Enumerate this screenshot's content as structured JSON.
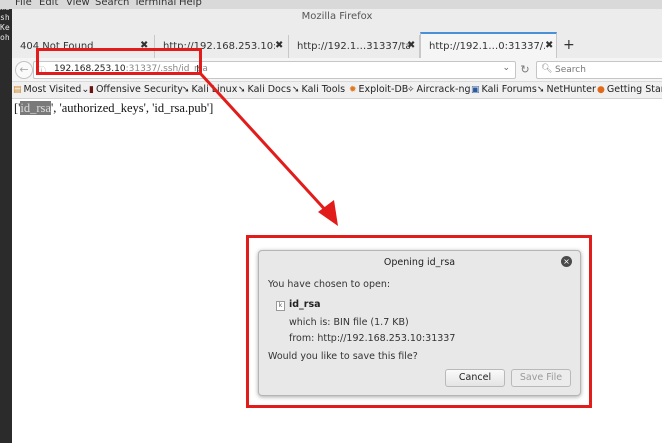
{
  "desktop": {
    "side_fragments": [
      "me",
      "sh",
      "Ke",
      "oh"
    ]
  },
  "os_menu": {
    "items": [
      "File",
      "Edit",
      "View",
      "Search",
      "Terminal",
      "Help"
    ]
  },
  "window": {
    "title": "Mozilla Firefox"
  },
  "tabs": [
    {
      "label": "404 Not Found",
      "close": "✖"
    },
    {
      "label": "http://192.168.253.10:31…",
      "close": "✖"
    },
    {
      "label": "http://192.1…31337/taxes/",
      "close": "✖"
    },
    {
      "label": "http://192.1…0:31337/.ssh",
      "close": "✖"
    }
  ],
  "newtab": "+",
  "navbar": {
    "back": "←",
    "info": "ⓘ",
    "url_host": "192.168.253.10",
    "url_rest": ":31337/.ssh/id_rsa",
    "url_drop": "⌄",
    "reload": "↻",
    "search_placeholder": "Search"
  },
  "bookmarks": [
    {
      "icon": "▤",
      "label": "Most Visited",
      "suffix": "⌄"
    },
    {
      "icon": "▮",
      "label": "Offensive Security"
    },
    {
      "icon": "➘",
      "label": "Kali Linux"
    },
    {
      "icon": "➘",
      "label": "Kali Docs"
    },
    {
      "icon": "➘",
      "label": "Kali Tools"
    },
    {
      "icon": "✹",
      "label": "Exploit-DB"
    },
    {
      "icon": "✧",
      "label": "Aircrack-ng"
    },
    {
      "icon": "▣",
      "label": "Kali Forums"
    },
    {
      "icon": "➘",
      "label": "NetHunter"
    },
    {
      "icon": "●",
      "label": "Getting Started"
    }
  ],
  "content": {
    "open": "['",
    "highlight": "id_rsa",
    "rest": "', 'authorized_keys', 'id_rsa.pub']"
  },
  "dialog": {
    "title": "Opening id_rsa",
    "close": "×",
    "chosen": "You have chosen to open:",
    "filename": "id_rsa",
    "which_is": "which is: BIN file (1.7 KB)",
    "from": "from: http://192.168.253.10:31337",
    "question": "Would you like to save this file?",
    "cancel": "Cancel",
    "save": "Save File"
  },
  "colors": {
    "highlight_red": "#e21b1b",
    "active_tab_accent": "#4a90d9"
  }
}
